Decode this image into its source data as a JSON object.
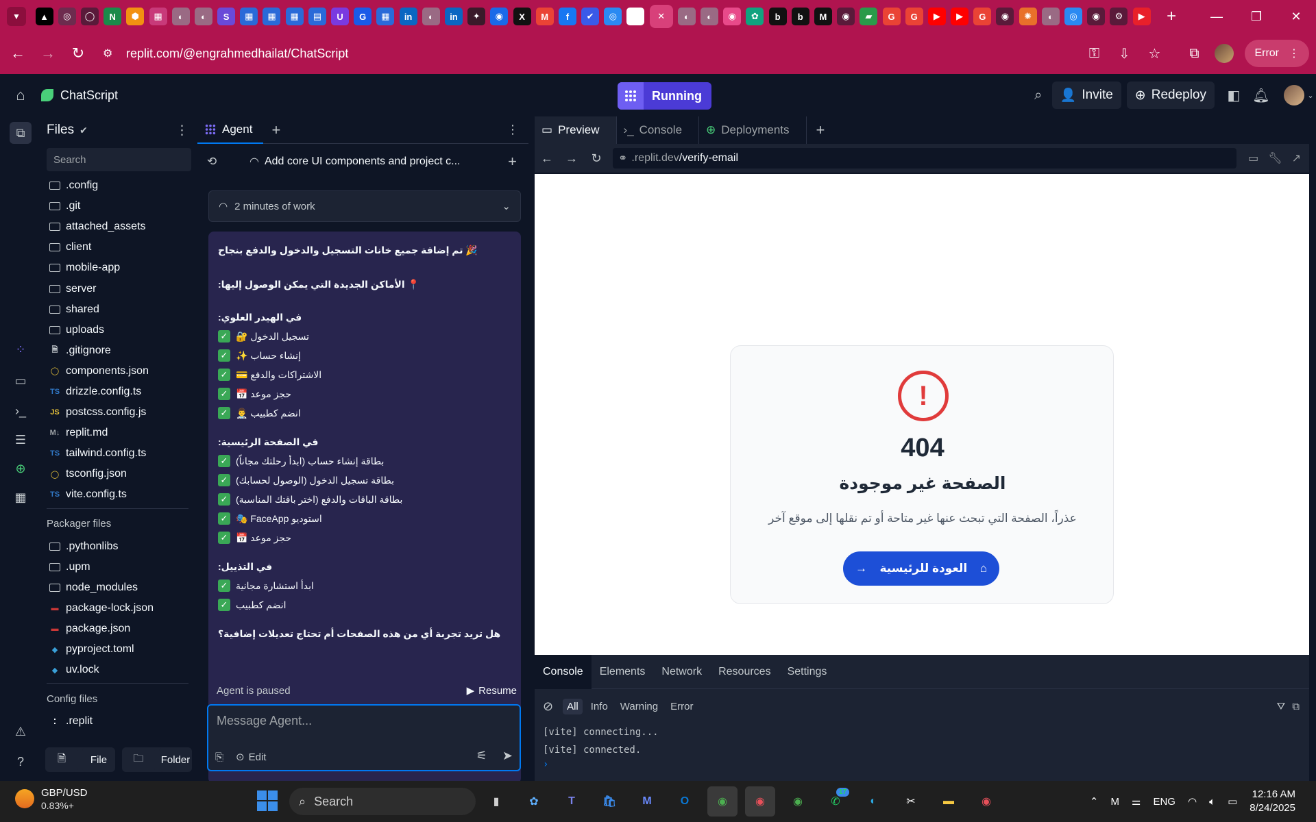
{
  "browser": {
    "tab_icons": [
      {
        "name": "tab-favicon-1",
        "glyph": "▲",
        "color": "#000000"
      },
      {
        "name": "tab-favicon-2",
        "glyph": "◎",
        "color": "#6d2b4e"
      },
      {
        "name": "tab-favicon-3",
        "glyph": "◯",
        "color": "#5a1a3a"
      },
      {
        "name": "tab-favicon-4",
        "glyph": "N",
        "color": "#1a8a4a"
      },
      {
        "name": "tab-favicon-5",
        "glyph": "⬢",
        "color": "#f29111"
      },
      {
        "name": "tab-favicon-6",
        "glyph": "▦",
        "color": "#c83a7a"
      },
      {
        "name": "tab-favicon-7",
        "glyph": "◐",
        "color": "#9a6a84"
      },
      {
        "name": "tab-favicon-8",
        "glyph": "◐",
        "color": "#9a6a84"
      },
      {
        "name": "tab-favicon-9",
        "glyph": "S",
        "color": "#6a4ad8"
      },
      {
        "name": "tab-favicon-10",
        "glyph": "▦",
        "color": "#2a6ad8"
      },
      {
        "name": "tab-favicon-11",
        "glyph": "▦",
        "color": "#2a6ad8"
      },
      {
        "name": "tab-favicon-12",
        "glyph": "▦",
        "color": "#2a6ad8"
      },
      {
        "name": "tab-favicon-13",
        "glyph": "▤",
        "color": "#2a6ad8"
      },
      {
        "name": "tab-favicon-14",
        "glyph": "U",
        "color": "#7a3ae0"
      },
      {
        "name": "tab-favicon-15",
        "glyph": "G",
        "color": "#1a5ae8"
      },
      {
        "name": "tab-favicon-16",
        "glyph": "▦",
        "color": "#2a6ad8"
      },
      {
        "name": "tab-favicon-17",
        "glyph": "in",
        "color": "#0a66c2"
      },
      {
        "name": "tab-favicon-18",
        "glyph": "◐",
        "color": "#9a6a84"
      },
      {
        "name": "tab-favicon-19",
        "glyph": "in",
        "color": "#0a66c2"
      },
      {
        "name": "tab-favicon-20",
        "glyph": "✦",
        "color": "#3a1a2a"
      },
      {
        "name": "tab-favicon-21",
        "glyph": "◉",
        "color": "#1a6ae8"
      },
      {
        "name": "tab-favicon-22",
        "glyph": "X",
        "color": "#111111"
      },
      {
        "name": "tab-favicon-23",
        "glyph": "M",
        "color": "#ea4335"
      },
      {
        "name": "tab-favicon-24",
        "glyph": "f",
        "color": "#1877f2"
      },
      {
        "name": "tab-favicon-25",
        "glyph": "✔",
        "color": "#3a5ae8"
      },
      {
        "name": "tab-favicon-26",
        "glyph": "◎",
        "color": "#2a8af2"
      },
      {
        "name": "tab-favicon-27",
        "glyph": "i",
        "color": "#ffffff"
      },
      {
        "name": "tab-favicon-28",
        "glyph": "◐",
        "color": "#9a6a84"
      },
      {
        "name": "tab-favicon-29",
        "glyph": "◐",
        "color": "#9a6a84"
      },
      {
        "name": "tab-favicon-30",
        "glyph": "◉",
        "color": "#e84a8a"
      },
      {
        "name": "tab-favicon-31",
        "glyph": "✿",
        "color": "#10a37f"
      },
      {
        "name": "tab-favicon-32",
        "glyph": "b",
        "color": "#111111"
      },
      {
        "name": "tab-favicon-33",
        "glyph": "b",
        "color": "#111111"
      },
      {
        "name": "tab-favicon-34",
        "glyph": "M",
        "color": "#111111"
      },
      {
        "name": "tab-favicon-35",
        "glyph": "◉",
        "color": "#5a1a3a"
      },
      {
        "name": "tab-favicon-36",
        "glyph": "▰",
        "color": "#2a9a4a"
      },
      {
        "name": "tab-favicon-37",
        "glyph": "G",
        "color": "#ea4335"
      },
      {
        "name": "tab-favicon-38",
        "glyph": "G",
        "color": "#ea4335"
      },
      {
        "name": "tab-favicon-39",
        "glyph": "▶",
        "color": "#ff0000"
      },
      {
        "name": "tab-favicon-40",
        "glyph": "▶",
        "color": "#ff0000"
      },
      {
        "name": "tab-favicon-41",
        "glyph": "G",
        "color": "#ea4335"
      },
      {
        "name": "tab-favicon-42",
        "glyph": "◉",
        "color": "#5a1a3a"
      },
      {
        "name": "tab-favicon-43",
        "glyph": "✺",
        "color": "#e8702a"
      },
      {
        "name": "tab-favicon-44",
        "glyph": "◐",
        "color": "#9a6a84"
      },
      {
        "name": "tab-favicon-45",
        "glyph": "◎",
        "color": "#2a8af2"
      },
      {
        "name": "tab-favicon-46",
        "glyph": "◉",
        "color": "#5a1a3a"
      },
      {
        "name": "tab-favicon-47",
        "glyph": "⚙",
        "color": "#5a1a3a"
      },
      {
        "name": "tab-favicon-48",
        "glyph": "▶",
        "color": "#e8202a"
      }
    ],
    "url": "replit.com/@engrahmedhailat/ChatScript",
    "profile_status": "Error"
  },
  "header": {
    "project_name": "ChatScript",
    "run_label": "Running",
    "invite_label": "Invite",
    "redeploy_label": "Redeploy"
  },
  "files": {
    "title": "Files",
    "search_placeholder": "Search",
    "items": [
      {
        "label": ".config",
        "type": "folder"
      },
      {
        "label": ".git",
        "type": "folder"
      },
      {
        "label": "attached_assets",
        "type": "folder"
      },
      {
        "label": "client",
        "type": "folder"
      },
      {
        "label": "mobile-app",
        "type": "folder"
      },
      {
        "label": "server",
        "type": "folder"
      },
      {
        "label": "shared",
        "type": "folder"
      },
      {
        "label": "uploads",
        "type": "folder"
      },
      {
        "label": ".gitignore",
        "type": "file"
      },
      {
        "label": "components.json",
        "type": "json"
      },
      {
        "label": "drizzle.config.ts",
        "type": "ts"
      },
      {
        "label": "postcss.config.js",
        "type": "js"
      },
      {
        "label": "replit.md",
        "type": "md"
      },
      {
        "label": "tailwind.config.ts",
        "type": "ts"
      },
      {
        "label": "tsconfig.json",
        "type": "json"
      },
      {
        "label": "vite.config.ts",
        "type": "ts"
      }
    ],
    "packager_title": "Packager files",
    "packager_items": [
      {
        "label": ".pythonlibs",
        "type": "folder"
      },
      {
        "label": ".upm",
        "type": "folder"
      },
      {
        "label": "node_modules",
        "type": "folder"
      },
      {
        "label": "package-lock.json",
        "type": "npm"
      },
      {
        "label": "package.json",
        "type": "npm"
      },
      {
        "label": "pyproject.toml",
        "type": "py"
      },
      {
        "label": "uv.lock",
        "type": "py"
      }
    ],
    "config_title": "Config files",
    "config_items": [
      {
        "label": ".replit",
        "type": "replit"
      }
    ],
    "new_file_label": "File",
    "new_folder_label": "Folder"
  },
  "agent": {
    "tab_label": "Agent",
    "thread_title": "Add core UI components and project c...",
    "work_summary": "2 minutes of work",
    "message": {
      "headline": "🎉 تم إضافة جميع خانات التسجيل والدخول والدفع بنجاح",
      "places_heading": "📍 الأماكن الجديدة التي يمكن الوصول إليها:",
      "header_section": "في الهيدر العلوي:",
      "header_items": [
        "تسجيل الدخول 🔐",
        "إنشاء حساب ✨",
        "الاشتراكات والدفع 💳",
        "حجز موعد 📅",
        "انضم كطبيب 👨‍⚕️"
      ],
      "home_section": "في الصفحة الرئيسية:",
      "home_items": [
        "بطاقة إنشاء حساب (ابدأ رحلتك مجاناً)",
        "بطاقة تسجيل الدخول (الوصول لحسابك)",
        "بطاقة الباقات والدفع (اختر باقتك المناسبة)",
        "استوديو FaceApp 🎭",
        "حجز موعد 📅"
      ],
      "footer_section": "في التذييل:",
      "footer_items": [
        "ابدأ استشارة مجانية",
        "انضم كطبيب"
      ],
      "question": "هل تريد تجربة أي من هذه الصفحات أم تحتاج تعديلات إضافية؟"
    },
    "paused_label": "Agent is paused",
    "resume_label": "Resume",
    "input_placeholder": "Message Agent...",
    "edit_label": "Edit"
  },
  "preview": {
    "tabs": [
      "Preview",
      "Console",
      "Deployments"
    ],
    "url_host": ".replit.dev",
    "url_path": "/verify-email",
    "page": {
      "code": "404",
      "title": "الصفحة غير موجودة",
      "description": "عذراً، الصفحة التي تبحث عنها غير متاحة أو تم نقلها إلى موقع آخر",
      "button_label": "العودة للرئيسية"
    },
    "devtools": {
      "tabs": [
        "Console",
        "Elements",
        "Network",
        "Resources",
        "Settings"
      ],
      "filters": [
        "All",
        "Info",
        "Warning",
        "Error"
      ],
      "logs": [
        "[vite] connecting...",
        "[vite] connected."
      ]
    }
  },
  "taskbar": {
    "ticker_symbol": "GBP/USD",
    "ticker_value": "0.83%+",
    "search_label": "Search",
    "language": "ENG",
    "time": "12:16 AM",
    "date": "8/24/2025",
    "teams_badge": "17"
  },
  "colors": {
    "browser_accent": "#b0144f",
    "run_button": "#4b3bd6",
    "agent_message_bg": "#28254e",
    "check_green": "#3aa856",
    "error_red": "#e03b3b",
    "primary_blue": "#1d4fd7"
  }
}
